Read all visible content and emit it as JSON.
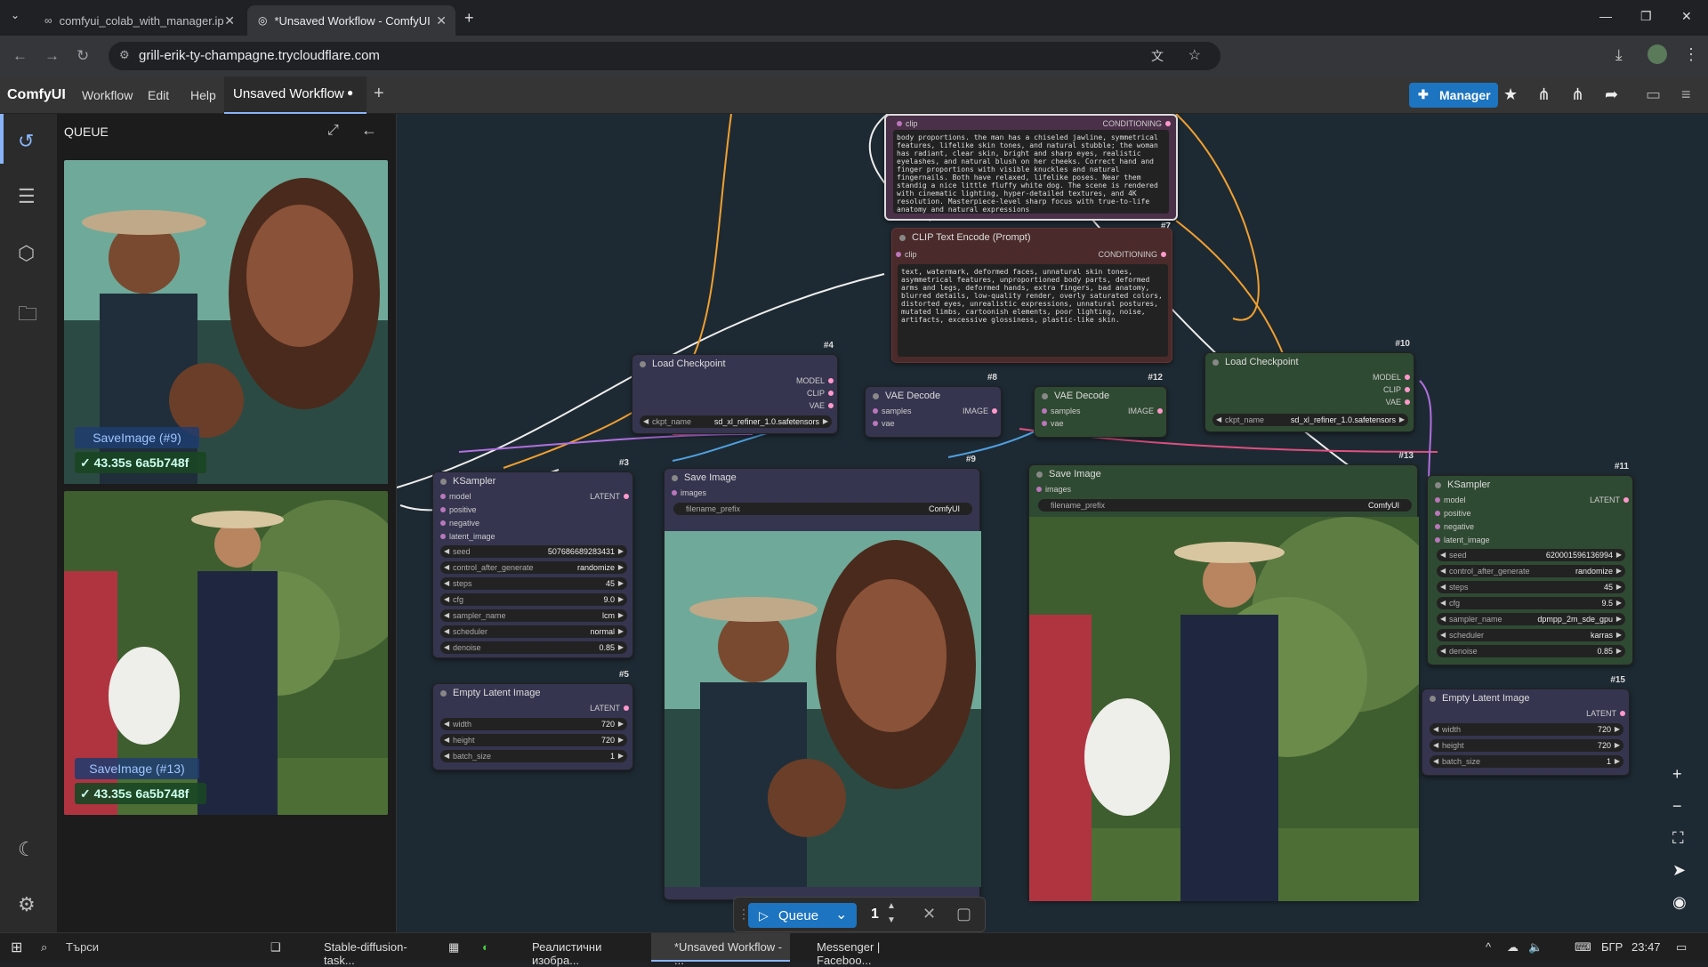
{
  "browser": {
    "tabs": [
      {
        "label": "comfyui_colab_with_manager.ip"
      },
      {
        "label": "*Unsaved Workflow - ComfyUI"
      }
    ],
    "url": "grill-erik-ty-champagne.trycloudflare.com"
  },
  "menu": {
    "brand": "ComfyUI",
    "items": [
      "Workflow",
      "Edit",
      "Help"
    ],
    "workflow_tab": "Unsaved Workflow",
    "manager_label": "Manager"
  },
  "queue_panel": {
    "title": "QUEUE",
    "items": [
      {
        "label": "SaveImage (#9)",
        "status": "✓ 43.35s 6a5b748f"
      },
      {
        "label": "SaveImage (#13)",
        "status": "✓ 43.35s 6a5b748f"
      }
    ]
  },
  "nodes": {
    "clip_top": {
      "in_clip": "clip",
      "out": "CONDITIONING",
      "num": "#7",
      "text": "body proportions. the man has a chiseled jawline, symmetrical features, lifelike skin tones, and natural stubble; the woman has radiant, clear skin, bright and sharp eyes, realistic eyelashes, and natural blush on her cheeks. Correct hand and finger proportions with visible knuckles and natural fingernails. Both have relaxed, lifelike poses.\nNear them standig a nice little fluffy white dog. The scene is rendered with cinematic lighting, hyper-detailed textures, and 4K resolution. Masterpiece-level sharp focus with true-to-life anatomy and natural expressions"
    },
    "clip_neg": {
      "title": "CLIP Text Encode (Prompt)",
      "in_clip": "clip",
      "out": "CONDITIONING",
      "text": "text, watermark, deformed faces, unnatural skin tones, asymmetrical features, unproportioned body parts, deformed arms and legs, deformed hands, extra fingers, bad anatomy, blurred details, low-quality render, overly saturated colors, distorted eyes, unrealistic expressions, unnatural postures, mutated limbs, cartoonish elements, poor lighting, noise, artifacts, excessive glossiness, plastic-like skin."
    },
    "load4": {
      "title": "Load Checkpoint",
      "num": "#4",
      "outs": [
        "MODEL",
        "CLIP",
        "VAE"
      ],
      "ckpt_label": "ckpt_name",
      "ckpt": "sd_xl_refiner_1.0.safetensors"
    },
    "vae8": {
      "title": "VAE Decode",
      "num": "#8",
      "ins": [
        "samples",
        "vae"
      ],
      "out": "IMAGE"
    },
    "vae12": {
      "title": "VAE Decode",
      "num": "#12",
      "ins": [
        "samples",
        "vae"
      ],
      "out": "IMAGE"
    },
    "load10": {
      "title": "Load Checkpoint",
      "num": "#10",
      "outs": [
        "MODEL",
        "CLIP",
        "VAE"
      ],
      "ckpt_label": "ckpt_name",
      "ckpt": "sd_xl_refiner_1.0.safetensors"
    },
    "ks3": {
      "title": "KSampler",
      "num": "#3",
      "ins": [
        "model",
        "positive",
        "negative",
        "latent_image"
      ],
      "out": "LATENT",
      "widgets": [
        {
          "k": "seed",
          "v": "507686689283431"
        },
        {
          "k": "control_after_generate",
          "v": "randomize"
        },
        {
          "k": "steps",
          "v": "45"
        },
        {
          "k": "cfg",
          "v": "9.0"
        },
        {
          "k": "sampler_name",
          "v": "lcm"
        },
        {
          "k": "scheduler",
          "v": "normal"
        },
        {
          "k": "denoise",
          "v": "0.85"
        }
      ]
    },
    "save9": {
      "title": "Save Image",
      "num": "#9",
      "in": "images",
      "prefix_label": "filename_prefix",
      "prefix": "ComfyUI"
    },
    "save13": {
      "title": "Save Image",
      "num": "#13",
      "in": "images",
      "prefix_label": "filename_prefix",
      "prefix": "ComfyUI"
    },
    "ks11": {
      "title": "KSampler",
      "num": "#11",
      "ins": [
        "model",
        "positive",
        "negative",
        "latent_image"
      ],
      "out": "LATENT",
      "widgets": [
        {
          "k": "seed",
          "v": "620001596136994"
        },
        {
          "k": "control_after_generate",
          "v": "randomize"
        },
        {
          "k": "steps",
          "v": "45"
        },
        {
          "k": "cfg",
          "v": "9.5"
        },
        {
          "k": "sampler_name",
          "v": "dpmpp_2m_sde_gpu"
        },
        {
          "k": "scheduler",
          "v": "karras"
        },
        {
          "k": "denoise",
          "v": "0.85"
        }
      ]
    },
    "empty5": {
      "title": "Empty Latent Image",
      "num": "#5",
      "out": "LATENT",
      "widgets": [
        {
          "k": "width",
          "v": "720"
        },
        {
          "k": "height",
          "v": "720"
        },
        {
          "k": "batch_size",
          "v": "1"
        }
      ]
    },
    "empty15": {
      "title": "Empty Latent Image",
      "num": "#15",
      "out": "LATENT",
      "widgets": [
        {
          "k": "width",
          "v": "720"
        },
        {
          "k": "height",
          "v": "720"
        },
        {
          "k": "batch_size",
          "v": "1"
        }
      ]
    }
  },
  "queue_bar": {
    "label": "Queue",
    "count": "1"
  },
  "taskbar": {
    "search": "Търси",
    "apps": [
      {
        "label": "Stable-diffusion-task..."
      },
      {
        "label": "Реалистични изобра..."
      },
      {
        "label": "*Unsaved Workflow - ..."
      },
      {
        "label": "Messenger | Faceboo..."
      }
    ],
    "lang": "БГР",
    "time": "23:47"
  },
  "colors": {
    "accent": "#1d74c0",
    "canvas_bg": "#1e2a33",
    "node_bg": "#353550",
    "green_node": "#2f4a32",
    "neg_node": "#4a2a2a"
  }
}
